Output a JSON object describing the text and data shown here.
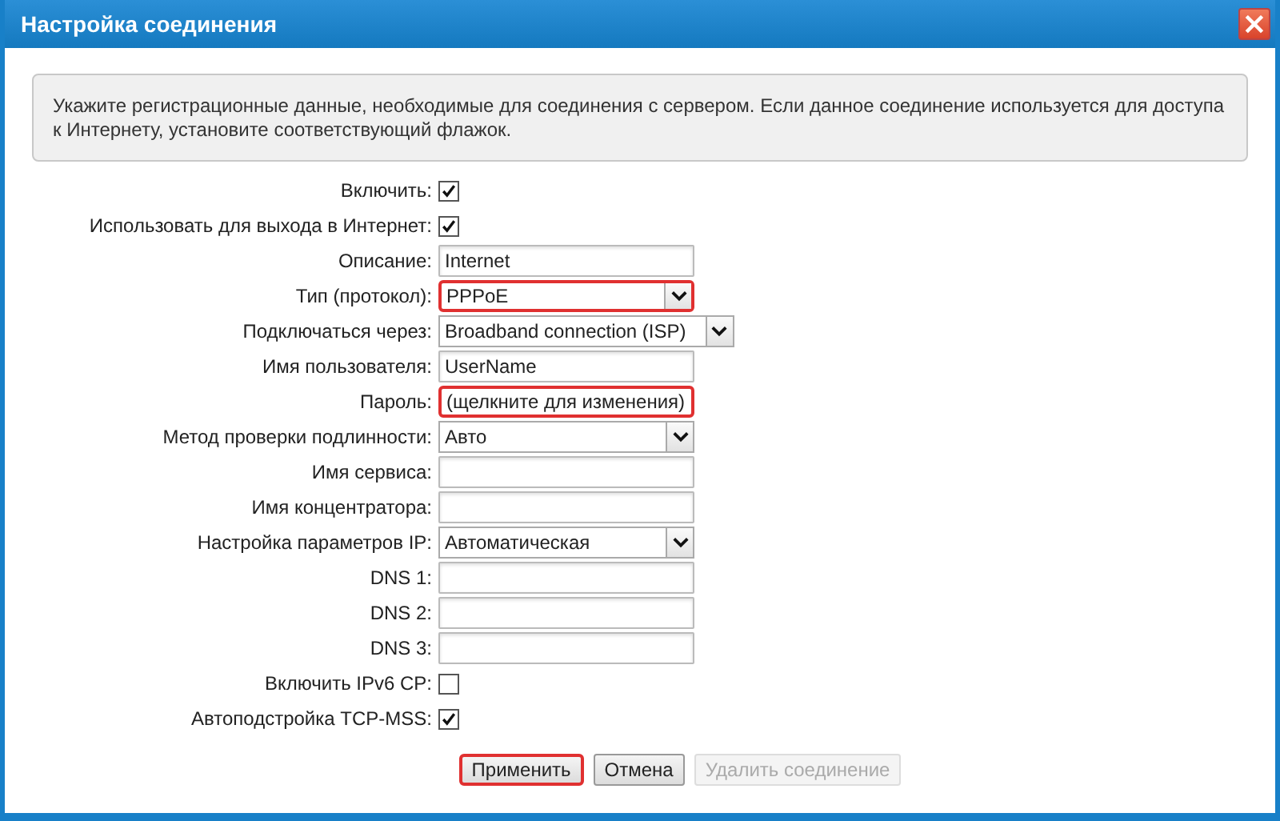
{
  "window": {
    "title": "Настройка соединения",
    "close": "×"
  },
  "info": "Укажите регистрационные данные, необходимые для соединения с сервером. Если данное соединение используется для доступа к Интернету, установите соответствующий флажок.",
  "fields": [
    {
      "kind": "checkbox",
      "label": "Включить:",
      "checked": true
    },
    {
      "kind": "checkbox",
      "label": "Использовать для выхода в Интернет:",
      "checked": true
    },
    {
      "kind": "text",
      "label": "Описание:",
      "value": "Internet",
      "highlighted": false
    },
    {
      "kind": "select",
      "label": "Тип (протокол):",
      "value": "PPPoE",
      "highlighted": true
    },
    {
      "kind": "select",
      "label": "Подключаться через:",
      "value": "Broadband connection (ISP)",
      "highlighted": false
    },
    {
      "kind": "text",
      "label": "Имя пользователя:",
      "value": "UserName",
      "highlighted": false
    },
    {
      "kind": "text",
      "label": "Пароль:",
      "value": "(щелкните для изменения)",
      "highlighted": true
    },
    {
      "kind": "select",
      "label": "Метод проверки подлинности:",
      "value": "Авто",
      "highlighted": false
    },
    {
      "kind": "text",
      "label": "Имя сервиса:",
      "highlighted": false
    },
    {
      "kind": "text",
      "label": "Имя концентратора:",
      "highlighted": false
    },
    {
      "kind": "select",
      "label": "Настройка параметров IP:",
      "value": "Автоматическая",
      "highlighted": false
    },
    {
      "kind": "text",
      "label": "DNS 1:",
      "highlighted": false
    },
    {
      "kind": "text",
      "label": "DNS 2:",
      "highlighted": false
    },
    {
      "kind": "text",
      "label": "DNS 3:",
      "highlighted": false
    },
    {
      "kind": "checkbox",
      "label": "Включить IPv6 CP:",
      "checked": false
    },
    {
      "kind": "checkbox",
      "label": "Автоподстройка TCP-MSS:",
      "checked": true
    }
  ],
  "buttons": [
    {
      "label": "Применить",
      "highlighted": true,
      "disabled": false
    },
    {
      "label": "Отмена",
      "highlighted": false,
      "disabled": false
    },
    {
      "label": "Удалить соединение",
      "highlighted": false,
      "disabled": true
    }
  ]
}
